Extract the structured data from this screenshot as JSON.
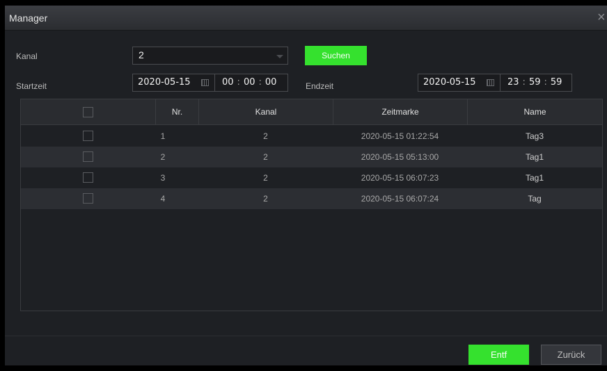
{
  "dialog": {
    "title": "Manager",
    "close_icon": "close-icon"
  },
  "form": {
    "channel_label": "Kanal",
    "channel_value": "2",
    "search_label": "Suchen",
    "start_label": "Startzeit",
    "start_date": "2020-05-15",
    "start_time": {
      "h": "00",
      "m": "00",
      "s": "00"
    },
    "end_label": "Endzeit",
    "end_date": "2020-05-15",
    "end_time": {
      "h": "23",
      "m": "59",
      "s": "59"
    }
  },
  "table": {
    "headers": {
      "nr": "Nr.",
      "channel": "Kanal",
      "timestamp": "Zeitmarke",
      "name": "Name"
    },
    "rows": [
      {
        "nr": "1",
        "channel": "2",
        "timestamp": "2020-05-15 01:22:54",
        "name": "Tag3"
      },
      {
        "nr": "2",
        "channel": "2",
        "timestamp": "2020-05-15 05:13:00",
        "name": "Tag1"
      },
      {
        "nr": "3",
        "channel": "2",
        "timestamp": "2020-05-15 06:07:23",
        "name": "Tag1"
      },
      {
        "nr": "4",
        "channel": "2",
        "timestamp": "2020-05-15 06:07:24",
        "name": "Tag"
      }
    ]
  },
  "footer": {
    "delete_label": "Entf",
    "back_label": "Zurück"
  },
  "colors": {
    "accent_green": "#35e12e",
    "panel": "#1e2024",
    "row_alt": "#2c2e33"
  }
}
